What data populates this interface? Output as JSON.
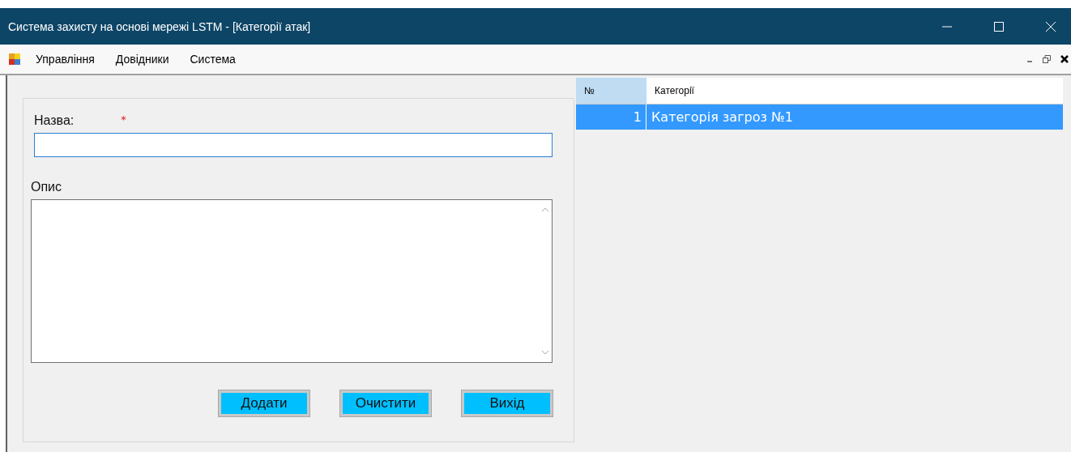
{
  "window": {
    "title": "Система захисту на основі мережі LSTM - [Категорії атак]"
  },
  "menu": [
    "Управління",
    "Довідники",
    "Система"
  ],
  "form": {
    "name_label": "Назва:",
    "required_mark": "*",
    "description_label": "Опис"
  },
  "buttons": [
    "Додати",
    "Очистити",
    "Вихід"
  ],
  "table": {
    "columns": [
      "№",
      "Категорії"
    ],
    "rows": [
      {
        "cells": [
          "1",
          "Категорія загроз №1"
        ],
        "selected": true
      }
    ]
  }
}
